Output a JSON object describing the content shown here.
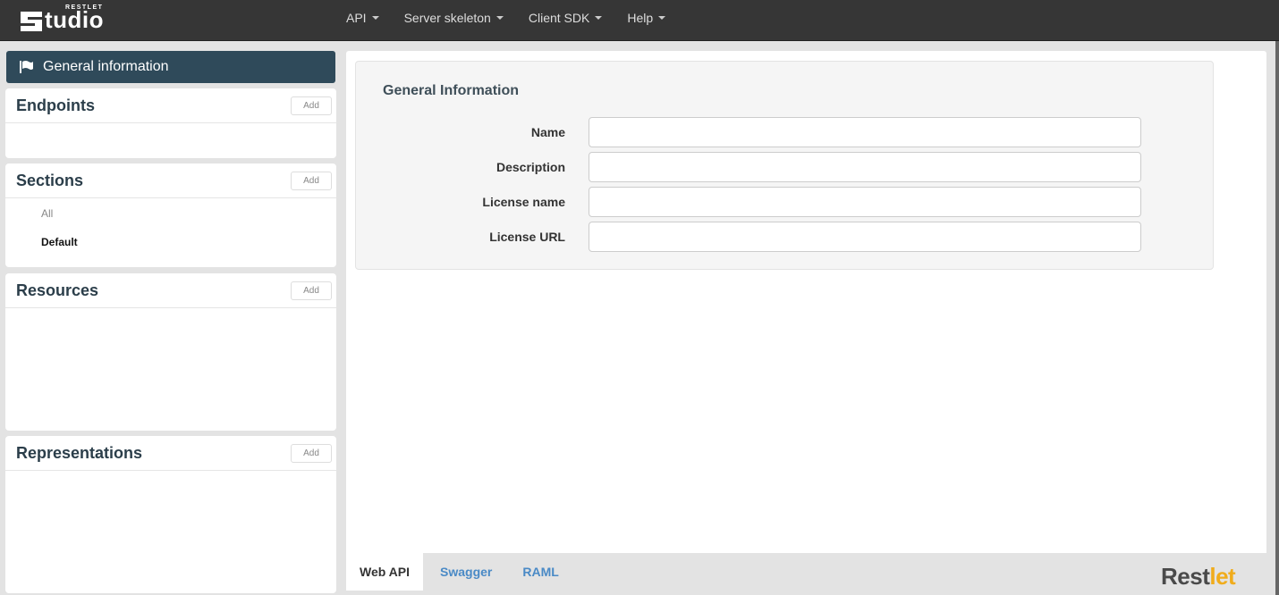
{
  "brand": {
    "small": "RESTLET",
    "word": "tudio"
  },
  "nav": {
    "items": [
      {
        "label": "API"
      },
      {
        "label": "Server skeleton"
      },
      {
        "label": "Client SDK"
      },
      {
        "label": "Help"
      }
    ]
  },
  "sidebar": {
    "active_item": "General information",
    "add_label": "Add",
    "panels": {
      "endpoints": {
        "title": "Endpoints"
      },
      "sections": {
        "title": "Sections",
        "items": [
          "All",
          "Default"
        ]
      },
      "resources": {
        "title": "Resources"
      },
      "representations": {
        "title": "Representations"
      }
    }
  },
  "form": {
    "title": "General Information",
    "fields": [
      {
        "label": "Name",
        "value": ""
      },
      {
        "label": "Description",
        "value": ""
      },
      {
        "label": "License name",
        "value": ""
      },
      {
        "label": "License URL",
        "value": ""
      }
    ]
  },
  "tabs": [
    {
      "label": "Web API",
      "active": true
    },
    {
      "label": "Swagger",
      "active": false
    },
    {
      "label": "RAML",
      "active": false
    }
  ],
  "footer_brand": {
    "part1": "Rest",
    "part2": "let"
  },
  "colors": {
    "navbar": "#363636",
    "sidebar_active": "#2f4a5a",
    "tab_link": "#4a8ac6",
    "brand_accent": "#f0ac1c"
  }
}
